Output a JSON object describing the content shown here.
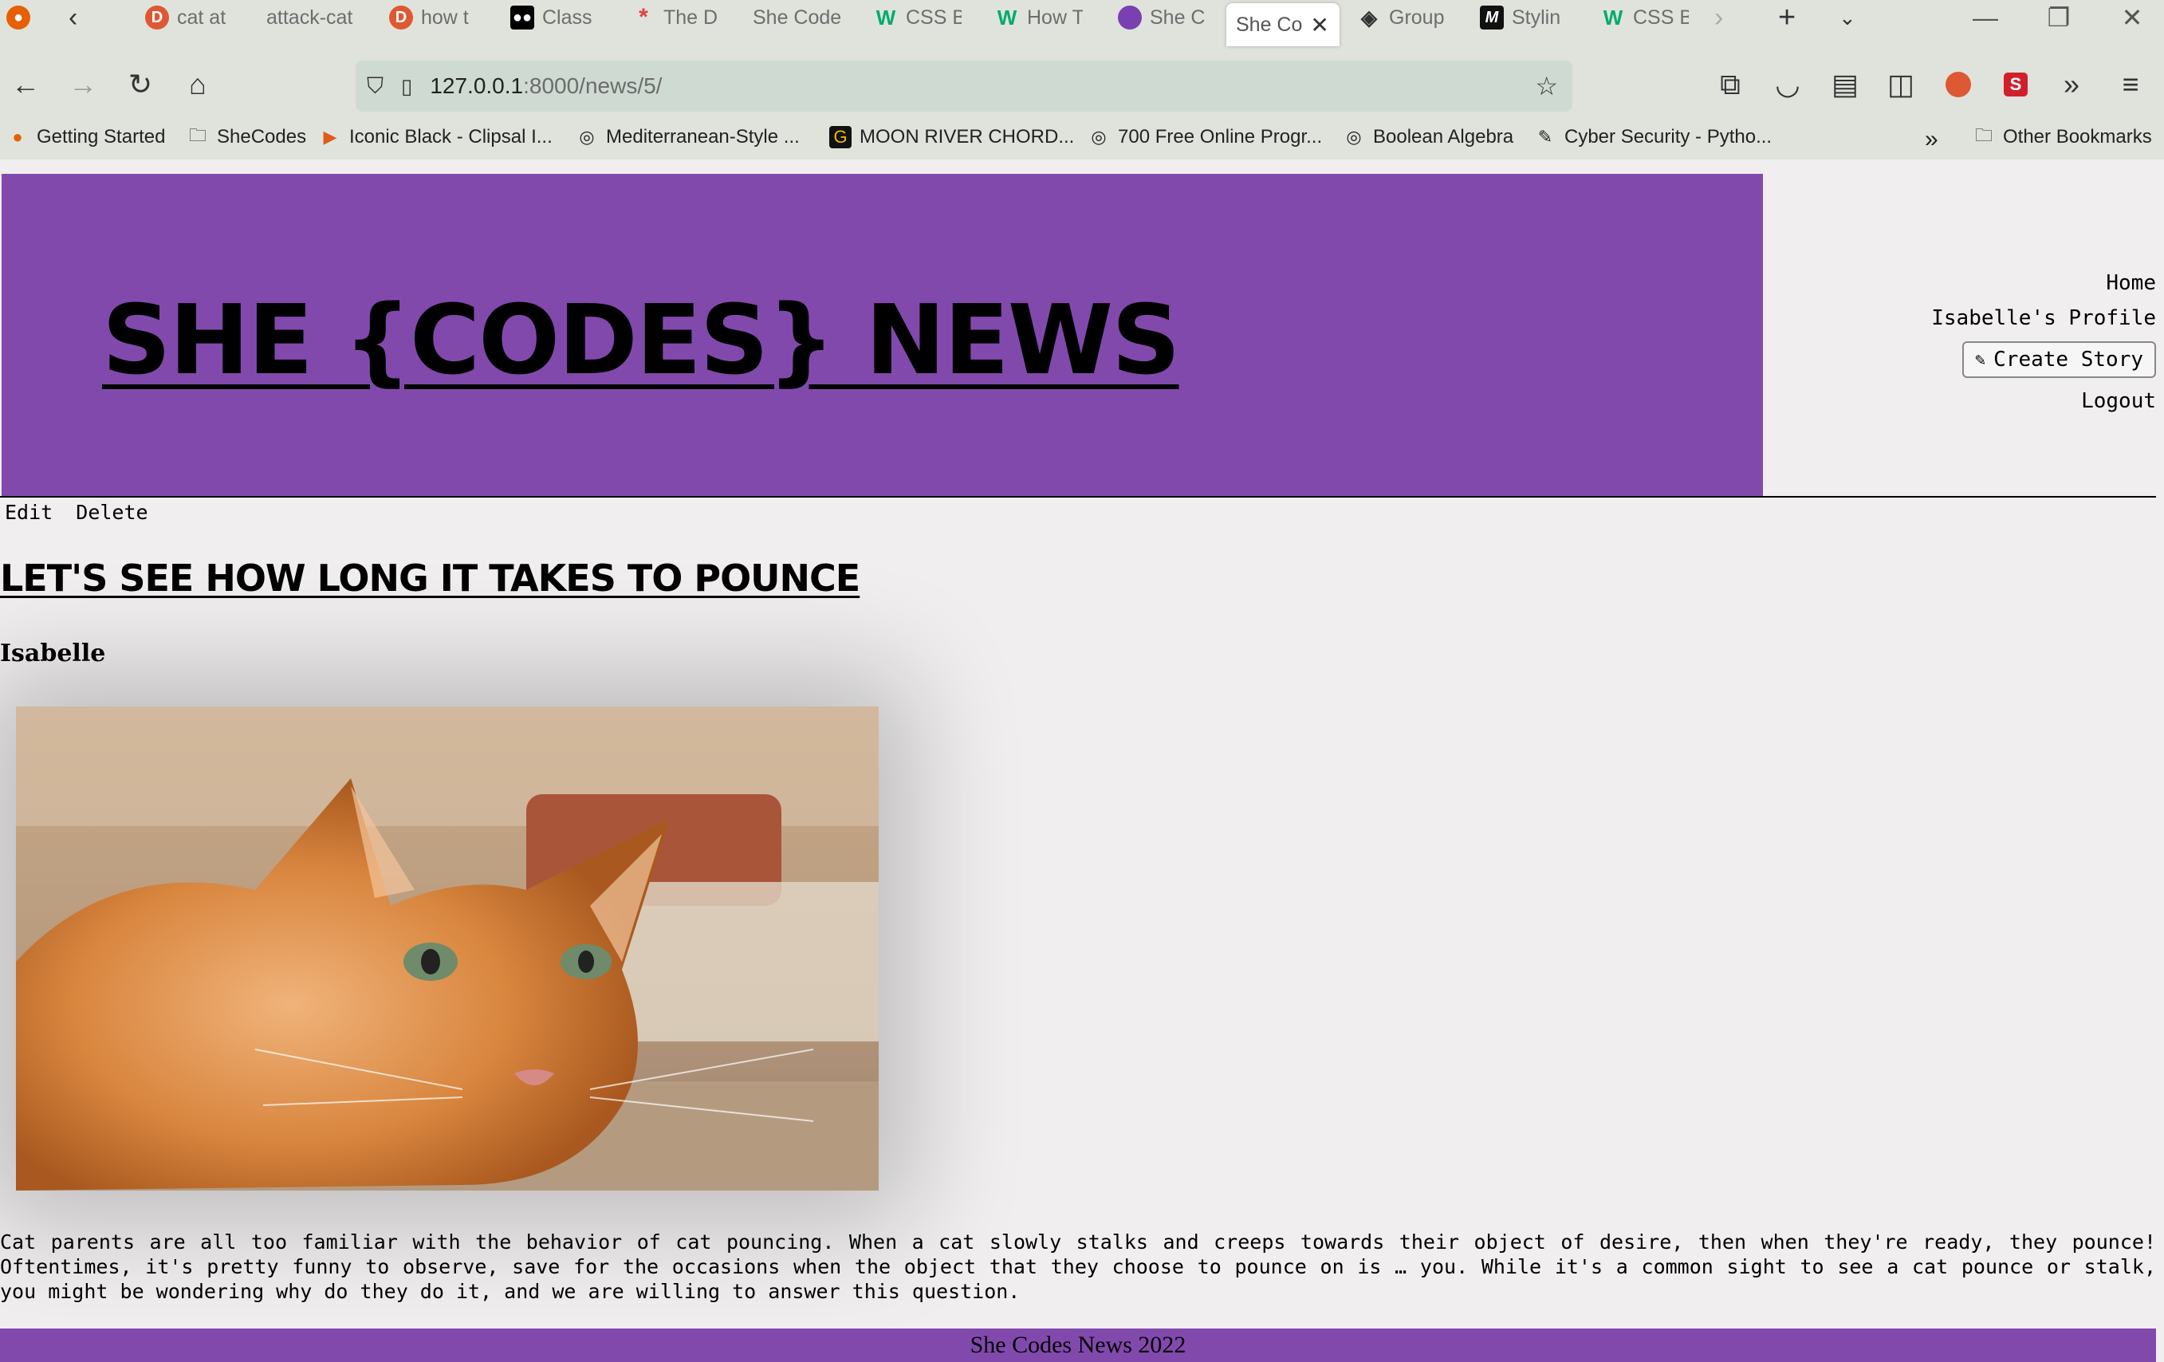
{
  "browser": {
    "tabs": [
      {
        "label": "cat at",
        "icon": "duckduckgo-icon"
      },
      {
        "label": "attack-cat",
        "icon": ""
      },
      {
        "label": "how t",
        "icon": "duckduckgo-icon"
      },
      {
        "label": "Class",
        "icon": "medium-icon"
      },
      {
        "label": "The D",
        "icon": "asterisk-icon"
      },
      {
        "label": "She Code",
        "icon": ""
      },
      {
        "label": "CSS B",
        "icon": "w3schools-icon"
      },
      {
        "label": "How T",
        "icon": "w3schools-icon"
      },
      {
        "label": "She C",
        "icon": "shecodes-icon"
      },
      {
        "label": "She Co",
        "icon": "",
        "active": true
      },
      {
        "label": "Group",
        "icon": "github-icon"
      },
      {
        "label": "Stylin",
        "icon": "m-icon"
      },
      {
        "label": "CSS B",
        "icon": "w3schools-icon"
      }
    ],
    "url_host": "127.0.0.1",
    "url_path": ":8000/news/5/",
    "bookmarks": [
      {
        "label": "Getting Started",
        "icon": "firefox-icon"
      },
      {
        "label": "SheCodes",
        "icon": "folder-icon"
      },
      {
        "label": "Iconic Black - Clipsal I...",
        "icon": "play-icon"
      },
      {
        "label": "Mediterranean-Style ...",
        "icon": "globe-icon"
      },
      {
        "label": "MOON RIVER CHORD...",
        "icon": "g-icon"
      },
      {
        "label": "700 Free Online Progr...",
        "icon": "globe-icon"
      },
      {
        "label": "Boolean Algebra",
        "icon": "globe-icon"
      },
      {
        "label": "Cyber Security - Pytho...",
        "icon": "feather-icon"
      }
    ],
    "other_bookmarks": "Other Bookmarks"
  },
  "site": {
    "title": "SHE {CODES} NEWS",
    "nav": {
      "home": "Home",
      "profile": "Isabelle's Profile",
      "create": "Create Story",
      "logout": "Logout"
    }
  },
  "story": {
    "edit": "Edit",
    "delete": "Delete",
    "title": "LET'S SEE HOW LONG IT TAKES TO POUNCE",
    "author": "Isabelle",
    "body": "Cat parents are all too familiar with the behavior of cat pouncing. When a cat slowly stalks and creeps towards their object of desire, then when they're ready, they pounce! Oftentimes, it's pretty funny to observe, save for the occasions when the object that they choose to pounce on is … you. While it's a common sight to see a cat pounce or stalk, you might be wondering why do they do it, and we are willing to answer this question."
  },
  "footer": "She Codes News 2022",
  "colors": {
    "brand": "#8249ad",
    "page_bg": "#f0eeef",
    "chrome_bg": "#dfe3dc"
  }
}
